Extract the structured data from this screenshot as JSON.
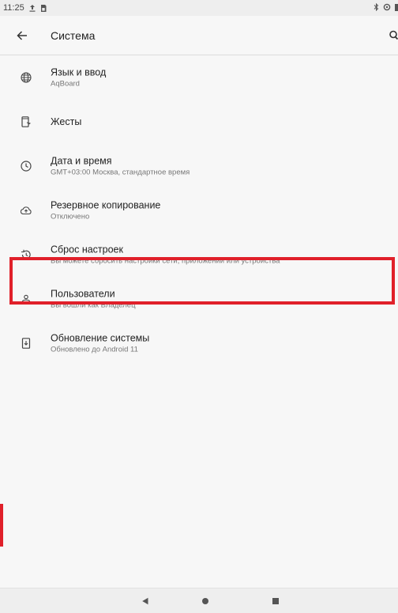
{
  "status_bar": {
    "time": "11:25",
    "left_icons": [
      "upload-icon",
      "sim-icon"
    ],
    "right_icons": [
      "bluetooth-icon",
      "data-saver-icon",
      "battery-icon"
    ]
  },
  "app_bar": {
    "title": "Система",
    "back_icon": "arrow-back-icon",
    "search_icon": "search-icon"
  },
  "items": [
    {
      "title": "Язык и ввод",
      "subtitle": "AqBoard",
      "icon": "globe-icon"
    },
    {
      "title": "Жесты",
      "subtitle": "",
      "icon": "gestures-phone-icon"
    },
    {
      "title": "Дата и время",
      "subtitle": "GMT+03:00 Москва, стандартное время",
      "icon": "clock-icon"
    },
    {
      "title": "Резервное копирование",
      "subtitle": "Отключено",
      "icon": "cloud-upload-icon"
    },
    {
      "title": "Сброс настроек",
      "subtitle": "Вы можете сбросить настройки сети, приложений или устройства",
      "icon": "history-icon"
    },
    {
      "title": "Пользователи",
      "subtitle": "Вы вошли как Владелец",
      "icon": "person-icon"
    },
    {
      "title": "Обновление системы",
      "subtitle": "Обновлено до Android 11",
      "icon": "system-update-icon"
    }
  ],
  "colors": {
    "highlight": "#e0202a",
    "background": "#f7f7f7"
  },
  "nav_bar": {
    "icons": [
      "nav-back-icon",
      "nav-home-icon",
      "nav-recents-icon"
    ]
  }
}
